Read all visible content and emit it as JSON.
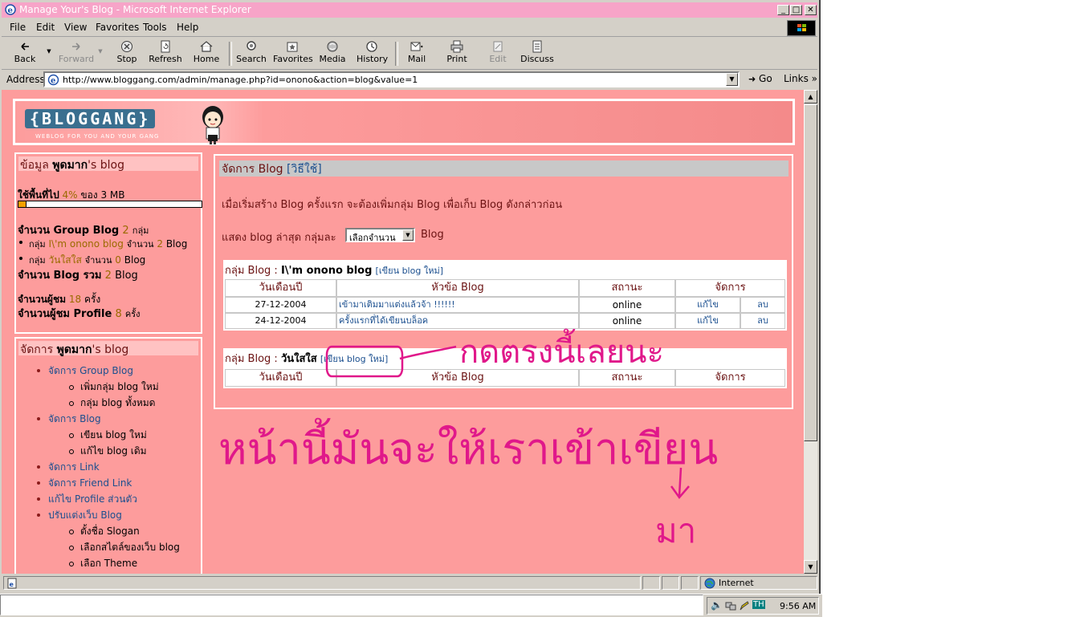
{
  "window": {
    "title": "Manage Your's Blog - Microsoft Internet Explorer",
    "minimize": "_",
    "maximize": "□",
    "close": "✕"
  },
  "menu": [
    "File",
    "Edit",
    "View",
    "Favorites",
    "Tools",
    "Help"
  ],
  "toolbar": {
    "back": "Back",
    "forward": "Forward",
    "stop": "Stop",
    "refresh": "Refresh",
    "home": "Home",
    "search": "Search",
    "favorites": "Favorites",
    "media": "Media",
    "history": "History",
    "mail": "Mail",
    "print": "Print",
    "edit": "Edit",
    "discuss": "Discuss"
  },
  "address": {
    "label": "Address",
    "url": "http://www.bloggang.com/admin/manage.php?id=onono&action=blog&value=1",
    "go": "Go",
    "links": "Links »"
  },
  "banner": {
    "logo": "{BLOGGANG}",
    "tagline": "WEBLOG FOR YOU AND YOUR GANG"
  },
  "info_panel": {
    "title_prefix": "ข้อมูล",
    "title_name": "พูดมาก",
    "title_suffix": "'s blog",
    "usage_label": "ใช้พื้นที่ไป",
    "usage_value": "4%",
    "usage_of": "ของ 3 MB",
    "usage_percent": 4,
    "group_count_label": "จำนวน Group Blog",
    "group_count_value": "2",
    "group_count_unit": "กลุ่ม",
    "groups": [
      {
        "prefix": "กลุ่ม",
        "name": "I\\'m onono blog",
        "count_label": "จำนวน",
        "count": "2",
        "unit": "Blog"
      },
      {
        "prefix": "กลุ่ม",
        "name": "วันใสใส",
        "count_label": "จำนวน",
        "count": "0",
        "unit": "Blog"
      }
    ],
    "total_label": "จำนวน Blog รวม",
    "total_value": "2",
    "total_unit": "Blog",
    "visitors_label": "จำนวนผู้ชม",
    "visitors_value": "18",
    "visitors_unit": "ครั้ง",
    "profile_label": "จำนวนผู้ชม Profile",
    "profile_value": "8",
    "profile_unit": "ครั้ง"
  },
  "manage_panel": {
    "title_prefix": "จัดการ",
    "title_name": "พูดมาก",
    "title_suffix": "'s blog",
    "items": [
      {
        "label": "จัดการ Group Blog",
        "level": 1
      },
      {
        "label": "เพิ่มกลุ่ม blog ใหม่",
        "level": 2
      },
      {
        "label": "กลุ่ม blog ทั้งหมด",
        "level": 2
      },
      {
        "label": "จัดการ Blog",
        "level": 1
      },
      {
        "label": "เขียน blog ใหม่",
        "level": 2
      },
      {
        "label": "แก้ไข blog เดิม",
        "level": 2
      },
      {
        "label": "จัดการ Link",
        "level": 1
      },
      {
        "label": "จัดการ Friend Link",
        "level": 1
      },
      {
        "label": "แก้ไข Profile ส่วนตัว",
        "level": 1
      },
      {
        "label": "ปรับแต่งเว็บ Blog",
        "level": 1
      },
      {
        "label": "ตั้งชื่อ Slogan",
        "level": 2
      },
      {
        "label": "เลือกสไตล์ของเว็บ blog",
        "level": 2
      },
      {
        "label": "เลือก Theme",
        "level": 2
      }
    ]
  },
  "main": {
    "title": "จัดการ Blog",
    "howto": "[วิธีใช้]",
    "intro": "เมื่อเริ่มสร้าง Blog ครั้งแรก จะต้องเพิ่มกลุ่ม Blog เพื่อเก็บ Blog ดังกล่าวก่อน",
    "show_prefix": "แสดง blog ล่าสุด กลุ่มละ",
    "select_value": "เลือกจำนวน",
    "show_suffix": "Blog",
    "columns": [
      "วันเดือนปี",
      "หัวข้อ Blog",
      "สถานะ",
      "จัดการ"
    ],
    "groups": [
      {
        "prefix": "กลุ่ม Blog :",
        "name": "I\\'m onono blog",
        "write_link": "[เขียน blog ใหม่]",
        "rows": [
          {
            "date": "27-12-2004",
            "title": "เข้ามาเติมมาแต่งแล้วจ้า !!!!!!",
            "status": "online",
            "edit": "แก้ไข",
            "delete": "ลบ"
          },
          {
            "date": "24-12-2004",
            "title": "ครั้งแรกที่ได้เขียนบล็อค",
            "status": "online",
            "edit": "แก้ไข",
            "delete": "ลบ"
          }
        ]
      },
      {
        "prefix": "กลุ่ม Blog :",
        "name": "วันใสใส",
        "write_link": "[เขียน blog ใหม่]",
        "rows": []
      }
    ]
  },
  "annotations": {
    "line1": "กดตรงนี้เลยนะ",
    "line2": "หน้านี้มันจะให้เราเข้าเขียน",
    "line3": "มา"
  },
  "status": {
    "zone": "Internet"
  },
  "tray": {
    "lang": "TH",
    "time": "9:56 AM"
  }
}
